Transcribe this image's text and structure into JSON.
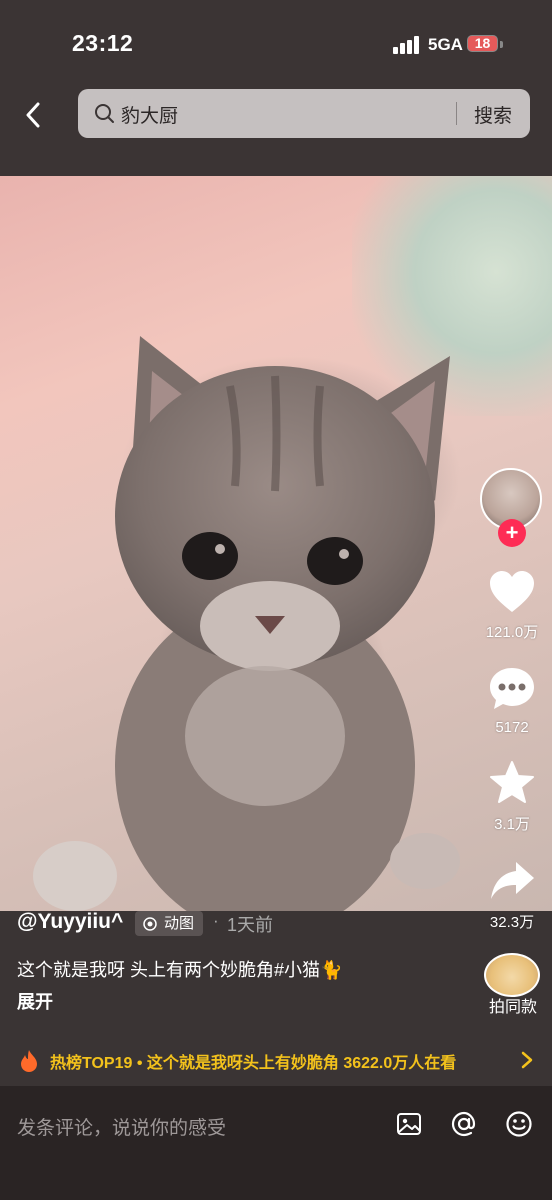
{
  "status_bar": {
    "time": "23:12",
    "network": "5GA",
    "battery": "18"
  },
  "search": {
    "query": "豹大厨",
    "button": "搜索"
  },
  "icons": {
    "back": "chevron-left-icon",
    "search": "search-icon",
    "like": "heart-icon",
    "comment": "comment-bubble-icon",
    "favorite": "star-icon",
    "share": "share-arrow-icon",
    "hot": "fire-icon",
    "image": "image-icon",
    "mention": "at-icon",
    "emoji": "emoji-icon"
  },
  "rail": {
    "follow": "+",
    "likes": "121.0万",
    "comments": "5172",
    "favorites": "3.1万",
    "shares": "32.3万",
    "same_style": "拍同款"
  },
  "post": {
    "author": "@Yuyyiiu^",
    "badge": "动图",
    "separator": "·",
    "time_ago": "1天前",
    "description": "这个就是我呀 头上有两个妙脆角#小猫🐈",
    "expand": "展开"
  },
  "hot_bar": {
    "text": "热榜TOP19 • 这个就是我呀头上有妙脆角  3622.0万人在看"
  },
  "comment_bar": {
    "placeholder": "发条评论，说说你的感受"
  },
  "colors": {
    "accent_red": "#fe2c55",
    "hot_yellow": "#f3c21c",
    "background": "#3b3434"
  }
}
